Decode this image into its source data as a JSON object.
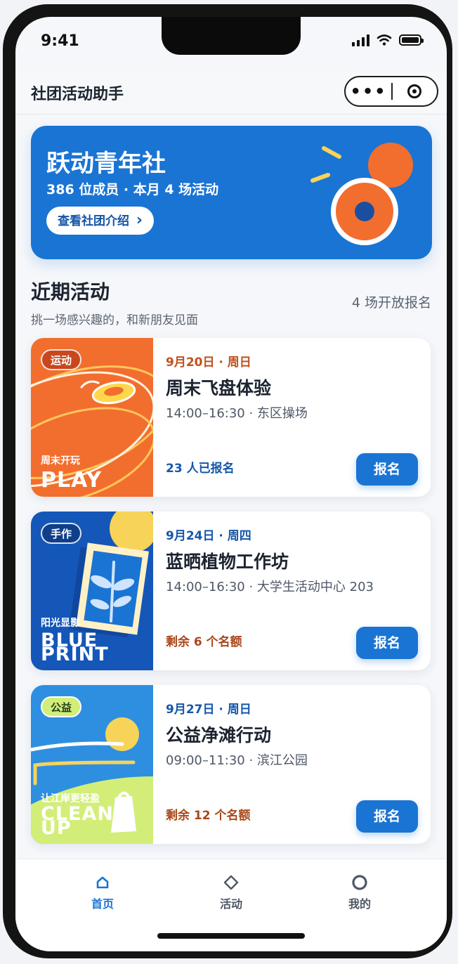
{
  "status_bar": {
    "time": "9:41"
  },
  "navbar": {
    "title": "社团活动助手"
  },
  "banner": {
    "title": "跃动青年社",
    "subtitle": "386 位成员 · 本月 4 场活动",
    "button_label": "查看社团介绍",
    "button_chevron": "›"
  },
  "section": {
    "title": "近期活动",
    "subtitle": "挑一场感兴趣的，和新朋友见面",
    "count_text": "4 场开放报名"
  },
  "events": [
    {
      "tag": "运动",
      "art_caption": "周末开玩",
      "art_big": "PLAY",
      "date": "9月20日 · 周日",
      "title": "周末飞盘体验",
      "meta": "14:00–16:30 · 东区操场",
      "status": "23 人已报名",
      "button": "报名"
    },
    {
      "tag": "手作",
      "art_caption": "阳光显影",
      "art_big": "BLUE PRINT",
      "art_big_lines": [
        "BLUE",
        "PRINT"
      ],
      "date": "9月24日 · 周四",
      "title": "蓝晒植物工作坊",
      "meta": "14:00–16:30 · 大学生活动中心 203",
      "status": "剩余 6 个名额",
      "button": "报名"
    },
    {
      "tag": "公益",
      "art_caption": "让江岸更轻盈",
      "art_big": "CLEAN UP",
      "art_big_lines": [
        "CLEAN",
        "UP"
      ],
      "date": "9月27日 · 周日",
      "title": "公益净滩行动",
      "meta": "09:00–11:30 · 滨江公园",
      "status": "剩余 12 个名额",
      "button": "报名"
    }
  ],
  "tabbar": {
    "items": [
      {
        "label": "首页",
        "icon": "home-icon",
        "active": true
      },
      {
        "label": "活动",
        "icon": "diamond-icon",
        "active": false
      },
      {
        "label": "我的",
        "icon": "profile-circle-icon",
        "active": false
      }
    ]
  },
  "colors": {
    "primary": "#1a74d3",
    "orange": "#f26e2f",
    "date_orange": "#c0501c",
    "date_blue": "#1557a8",
    "status_blue": "#1557a8",
    "status_orange": "#a8471a"
  }
}
